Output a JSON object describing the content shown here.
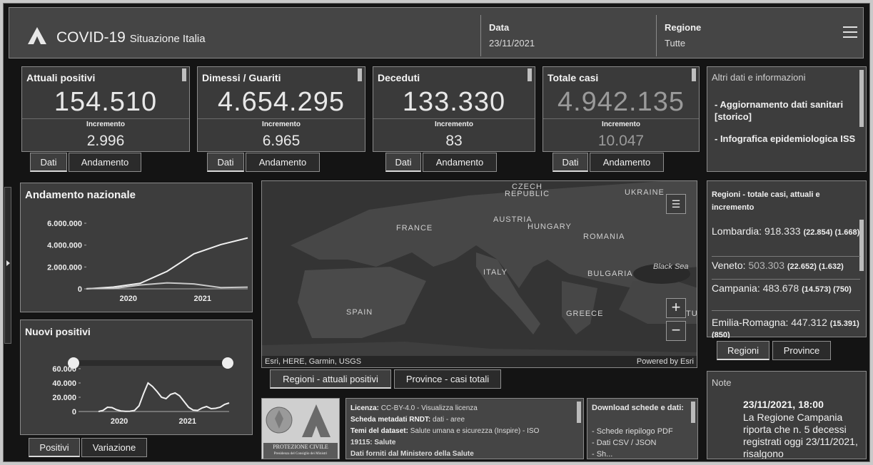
{
  "header": {
    "title_main": "COVID-19",
    "title_sub": "Situazione Italia",
    "data_label": "Data",
    "data_value": "23/11/2021",
    "regione_label": "Regione",
    "regione_value": "Tutte",
    "menu_icon": "hamburger-menu-icon"
  },
  "kpis": [
    {
      "title": "Attuali positivi",
      "value": "154.510",
      "inc_label": "Incremento",
      "inc_value": "2.996"
    },
    {
      "title": "Dimessi / Guariti",
      "value": "4.654.295",
      "inc_label": "Incremento",
      "inc_value": "6.965"
    },
    {
      "title": "Deceduti",
      "value": "133.330",
      "inc_label": "Incremento",
      "inc_value": "83"
    },
    {
      "title": "Totale casi",
      "value": "4.942.135",
      "inc_label": "Incremento",
      "inc_value": "10.047"
    }
  ],
  "kpi_tabs": {
    "dati": "Dati",
    "andamento": "Andamento"
  },
  "altri_dati": {
    "title": "Altri dati e informazioni",
    "link1": "- Aggiornamento dati sanitari [storico]",
    "link2": "- Infografica epidemiologica ISS"
  },
  "regions": {
    "title": "Regioni - totale casi, attuali e incremento",
    "rows": [
      {
        "name": "Lombardia:",
        "total": "918.333",
        "stats": "(22.854) (1.668)"
      },
      {
        "name": "Veneto:",
        "total": "503.303",
        "stats": "(22.652) (1.632)"
      },
      {
        "name": "Campania:",
        "total": "483.678",
        "stats": "(14.573) (750)"
      },
      {
        "name": "Emilia-Romagna:",
        "total": "447.312",
        "stats": "(15.391) (850)"
      }
    ],
    "tab_regioni": "Regioni",
    "tab_province": "Province"
  },
  "andamento": {
    "title": "Andamento nazionale",
    "chart_data": {
      "type": "line",
      "title": "Andamento nazionale",
      "x": [
        "2020-02",
        "2020-06",
        "2020-10",
        "2021-01",
        "2021-04",
        "2021-07",
        "2021-11"
      ],
      "y_ticks": [
        "6.000.000",
        "4.000.000",
        "2.000.000",
        "0"
      ],
      "x_ticks": [
        "2020",
        "2021"
      ],
      "ylim": [
        0,
        6000000
      ],
      "series": [
        {
          "values": [
            2000,
            160000,
            500000,
            1600000,
            3200000,
            4050000,
            4654295
          ]
        },
        {
          "values": [
            20000,
            30000,
            350000,
            550000,
            450000,
            120000,
            154510
          ]
        }
      ]
    }
  },
  "nuovi": {
    "title": "Nuovi positivi",
    "chart_data": {
      "type": "line",
      "title": "Nuovi positivi",
      "y_ticks": [
        "60.000",
        "40.000",
        "20.000",
        "0"
      ],
      "x_ticks": [
        "2020",
        "2021"
      ],
      "ylim": [
        0,
        60000
      ],
      "series": [
        {
          "values": [
            0,
            1500,
            6000,
            5500,
            2500,
            800,
            300,
            400,
            1500,
            8000,
            25000,
            40000,
            35000,
            28000,
            20000,
            18000,
            24000,
            26000,
            22000,
            14000,
            6000,
            2000,
            1500,
            5000,
            7000,
            4000,
            4500,
            6000,
            10000,
            12000
          ]
        }
      ]
    },
    "tab_positivi": "Positivi",
    "tab_variazione": "Variazione"
  },
  "map": {
    "labels": [
      "CZECH",
      "REPUBLIC",
      "UKRAINE",
      "FRANCE",
      "AUSTRIA",
      "HUNGARY",
      "ROMANIA",
      "ITALY",
      "BULGARIA",
      "Black Sea",
      "SPAIN",
      "GREECE",
      "TURKEY"
    ],
    "attribution": "Esri, HERE, Garmin, USGS",
    "powered": "Powered by Esri",
    "zoom_in": "+",
    "zoom_out": "−",
    "tab_regioni": "Regioni - attuali positivi",
    "tab_province": "Province - casi totali"
  },
  "license": {
    "l1_b": "Licenza:",
    "l1": "CC-BY-4.0 - Visualizza licenza",
    "l2_b": "Scheda metadati RNDT:",
    "l2": "dati - aree",
    "l3_b": "Temi del dataset:",
    "l3": "Salute umana e sicurezza (Inspire) - ISO",
    "l4": "19115: Salute",
    "l5": "Dati forniti dal Ministero della Salute",
    "logo_text": "PROTEZIONE CIVILE",
    "logo_sub": "Presidenza del Consiglio dei Ministri"
  },
  "download": {
    "title": "Download schede e dati:",
    "item1": "- Schede riepilogo PDF",
    "item2": "- Dati CSV / JSON",
    "item3": "- Sh..."
  },
  "note": {
    "title": "Note",
    "date": "23/11/2021, 18:00",
    "text": "La Regione Campania riporta che n. 5 decessi registrati oggi 23/11/2021, risalgono"
  }
}
